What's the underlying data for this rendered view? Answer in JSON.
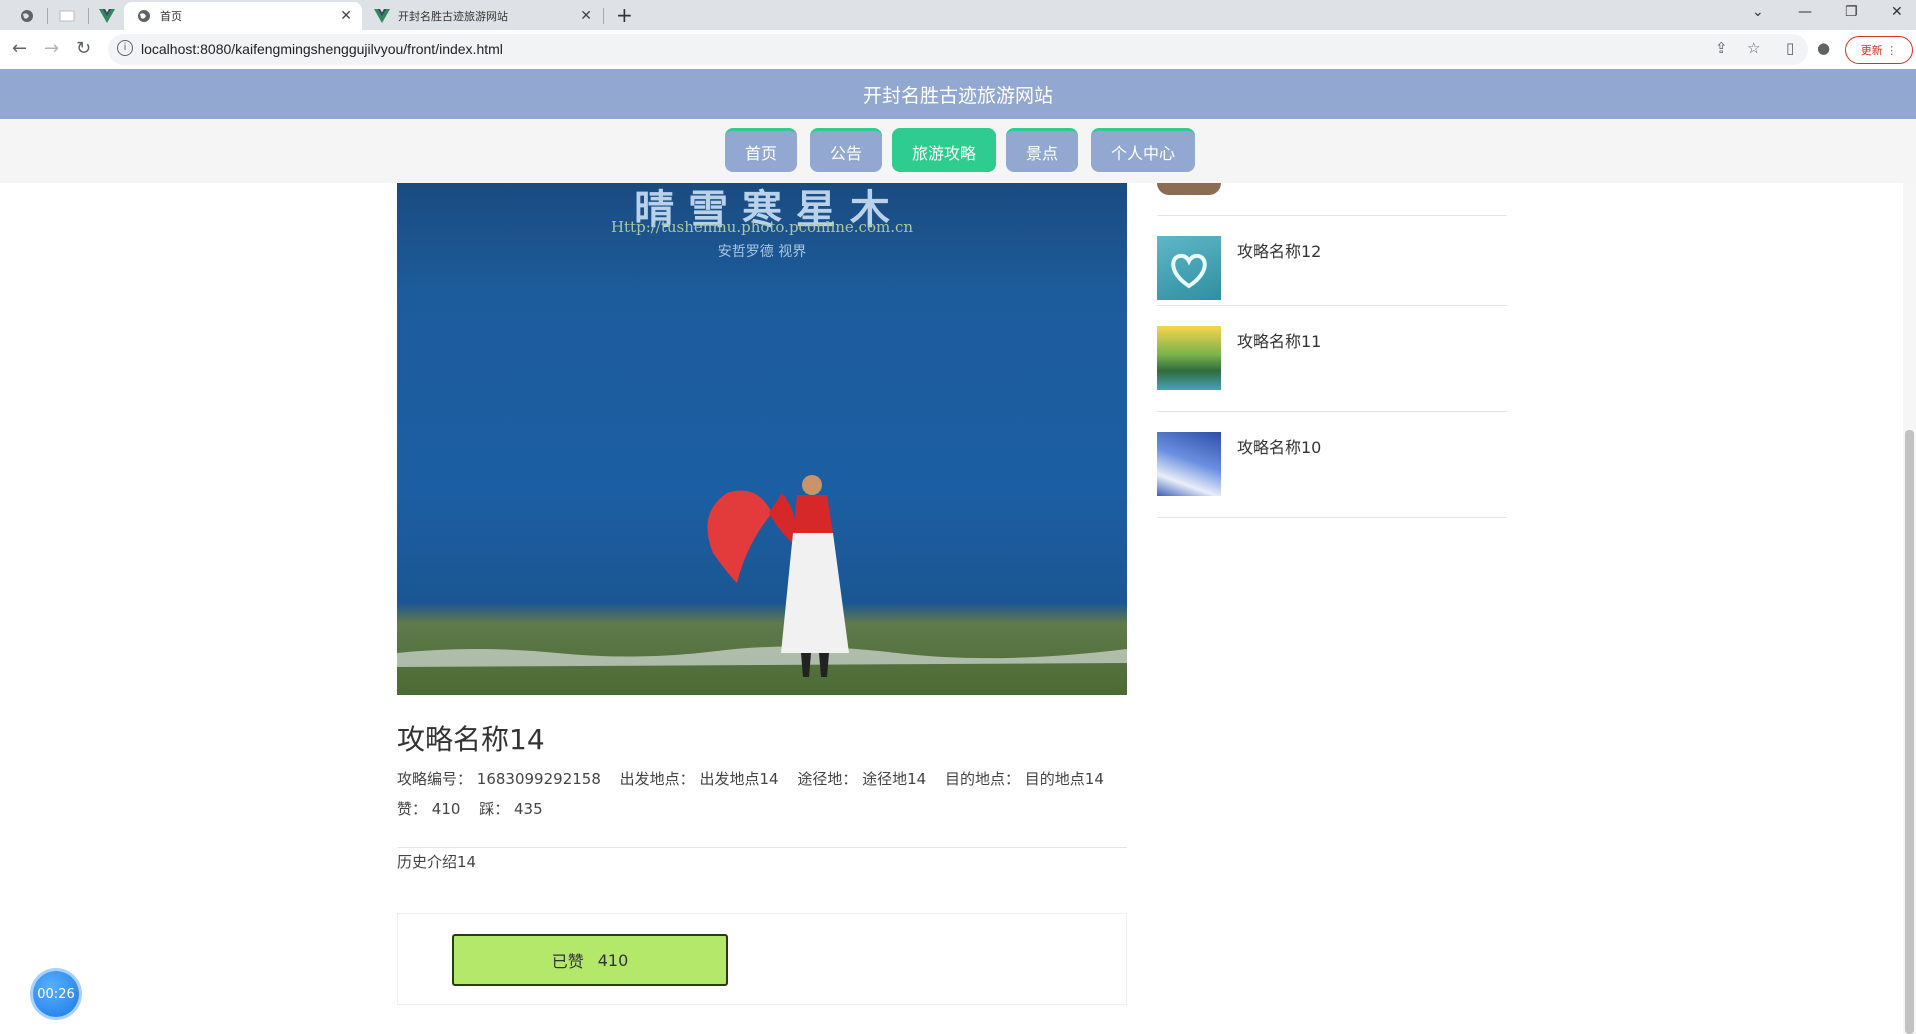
{
  "browser": {
    "tabs": [
      {
        "title": "首页",
        "active": true
      },
      {
        "title": "开封名胜古迹旅游网站",
        "active": false
      }
    ],
    "url": "localhost:8080/kaifengmingshenggujilvyou/front/index.html",
    "update_label": "更新"
  },
  "site": {
    "title": "开封名胜古迹旅游网站",
    "nav": [
      {
        "label": "首页"
      },
      {
        "label": "公告"
      },
      {
        "label": "旅游攻略",
        "active": true
      },
      {
        "label": "景点"
      },
      {
        "label": "个人中心"
      }
    ]
  },
  "image": {
    "watermark_line1": "晴 雪 寒 星 木",
    "watermark_line2": "Http://tushenmu.photo.pconline.com.cn",
    "watermark_line3": "安哲罗德   视界"
  },
  "article": {
    "title": "攻略名称14",
    "meta": {
      "id_label": "攻略编号：",
      "id_value": "1683099292158",
      "start_label": "出发地点：",
      "start_value": "出发地点14",
      "via_label": "途径地：",
      "via_value": "途径地14",
      "dest_label": "目的地点：",
      "dest_value": "目的地点14",
      "like_label": "赞：",
      "like_value": "410",
      "dislike_label": "踩：",
      "dislike_value": "435"
    },
    "intro": "历史介绍14",
    "like_button": {
      "label": "已赞",
      "count": "410"
    }
  },
  "sidebar": {
    "items": [
      {
        "title": "攻略名称12"
      },
      {
        "title": "攻略名称11"
      },
      {
        "title": "攻略名称10"
      }
    ]
  },
  "timer": "00:26"
}
